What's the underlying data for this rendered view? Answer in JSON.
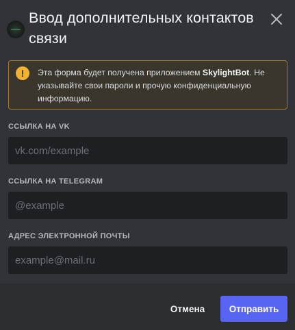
{
  "modal": {
    "title": "Ввод дополнительных контактов связи",
    "close_icon": "close-icon",
    "app_avatar_icon": "app-avatar"
  },
  "warning": {
    "icon": "exclamation-icon",
    "text_before": "Эта форма будет получена приложением ",
    "app_name": "SkylightBot",
    "text_after": ". Не указывайте свои пароли и прочую конфиденциальную информацию."
  },
  "fields": [
    {
      "label": "ССЫЛКА НА VK",
      "placeholder": "vk.com/example",
      "value": ""
    },
    {
      "label": "ССЫЛКА НА TELEGRAM",
      "placeholder": "@example",
      "value": ""
    },
    {
      "label": "АДРЕС ЭЛЕКТРОННОЙ ПОЧТЫ",
      "placeholder": "example@mail.ru",
      "value": ""
    }
  ],
  "footer": {
    "cancel_label": "Отмена",
    "submit_label": "Отправить"
  },
  "colors": {
    "background": "#313338",
    "footer_background": "#2b2d31",
    "input_background": "#1e1f22",
    "warning_border": "#a37b2a",
    "warning_icon": "#f0b232",
    "primary_button": "#5865f2"
  }
}
